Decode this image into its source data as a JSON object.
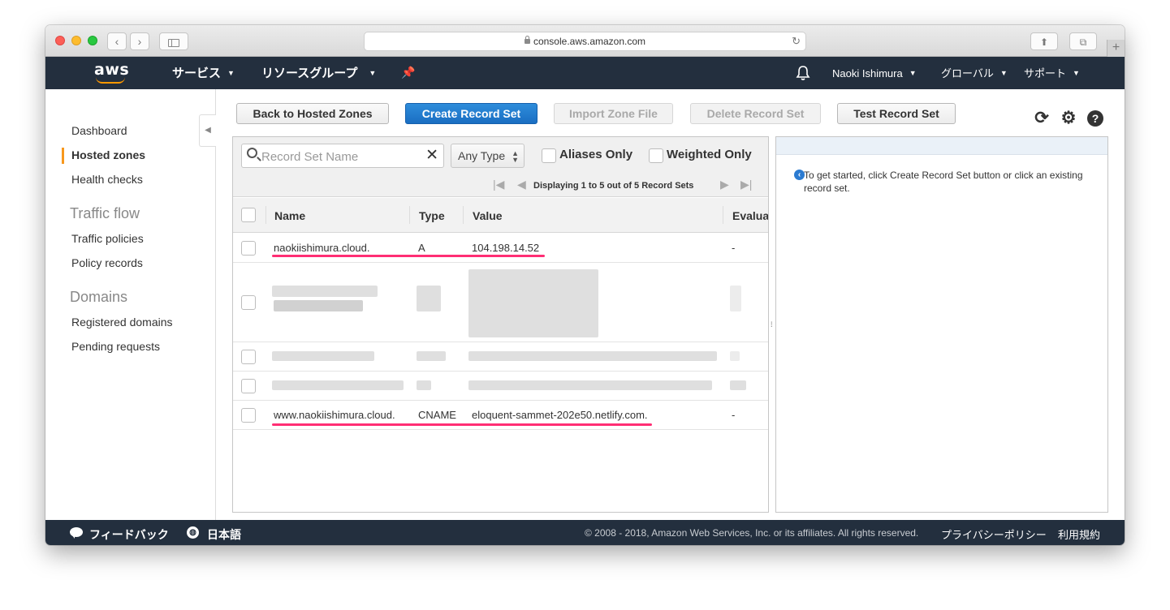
{
  "browser": {
    "url": "console.aws.amazon.com",
    "back_icon": "chevron-left",
    "forward_icon": "chevron-right",
    "new_tab": "+"
  },
  "topnav": {
    "logo": "aws",
    "services": "サービス",
    "resource_groups": "リソースグループ",
    "user": "Naoki Ishimura",
    "region": "グローバル",
    "support": "サポート"
  },
  "sidebar": {
    "items": [
      {
        "label": "Dashboard"
      },
      {
        "label": "Hosted zones",
        "active": true
      },
      {
        "label": "Health checks"
      }
    ],
    "traffic_heading": "Traffic flow",
    "traffic_items": [
      {
        "label": "Traffic policies"
      },
      {
        "label": "Policy records"
      }
    ],
    "domains_heading": "Domains",
    "domain_items": [
      {
        "label": "Registered domains"
      },
      {
        "label": "Pending requests"
      }
    ]
  },
  "toolbar": {
    "back": "Back to Hosted Zones",
    "create": "Create Record Set",
    "import": "Import Zone File",
    "delete": "Delete Record Set",
    "test": "Test Record Set"
  },
  "filter": {
    "search_placeholder": "Record Set Name",
    "type_select": "Any Type",
    "aliases_only": "Aliases Only",
    "weighted_only": "Weighted Only",
    "pager_text": "Displaying 1 to 5 out of 5 Record Sets"
  },
  "table": {
    "columns": [
      "Name",
      "Type",
      "Value",
      "Evalua"
    ],
    "rows": [
      {
        "name": "naokiishimura.cloud.",
        "type": "A",
        "value": "104.198.14.52",
        "eval": "-"
      },
      {
        "name": "www.naokiishimura.cloud.",
        "type": "CNAME",
        "value": "eloquent-sammet-202e50.netlify.com.",
        "eval": "-"
      }
    ]
  },
  "info": {
    "text": "To get started, click Create Record Set button or click an existing record set."
  },
  "footer": {
    "feedback": "フィードバック",
    "language": "日本語",
    "copyright": "© 2008 - 2018, Amazon Web Services, Inc. or its affiliates. All rights reserved.",
    "privacy": "プライバシーポリシー",
    "terms": "利用規約"
  },
  "colors": {
    "aws_nav": "#232f3e",
    "primary_button": "#1a6ec2",
    "highlight_underline": "#ff2e74",
    "active_marker": "#f7981d"
  }
}
